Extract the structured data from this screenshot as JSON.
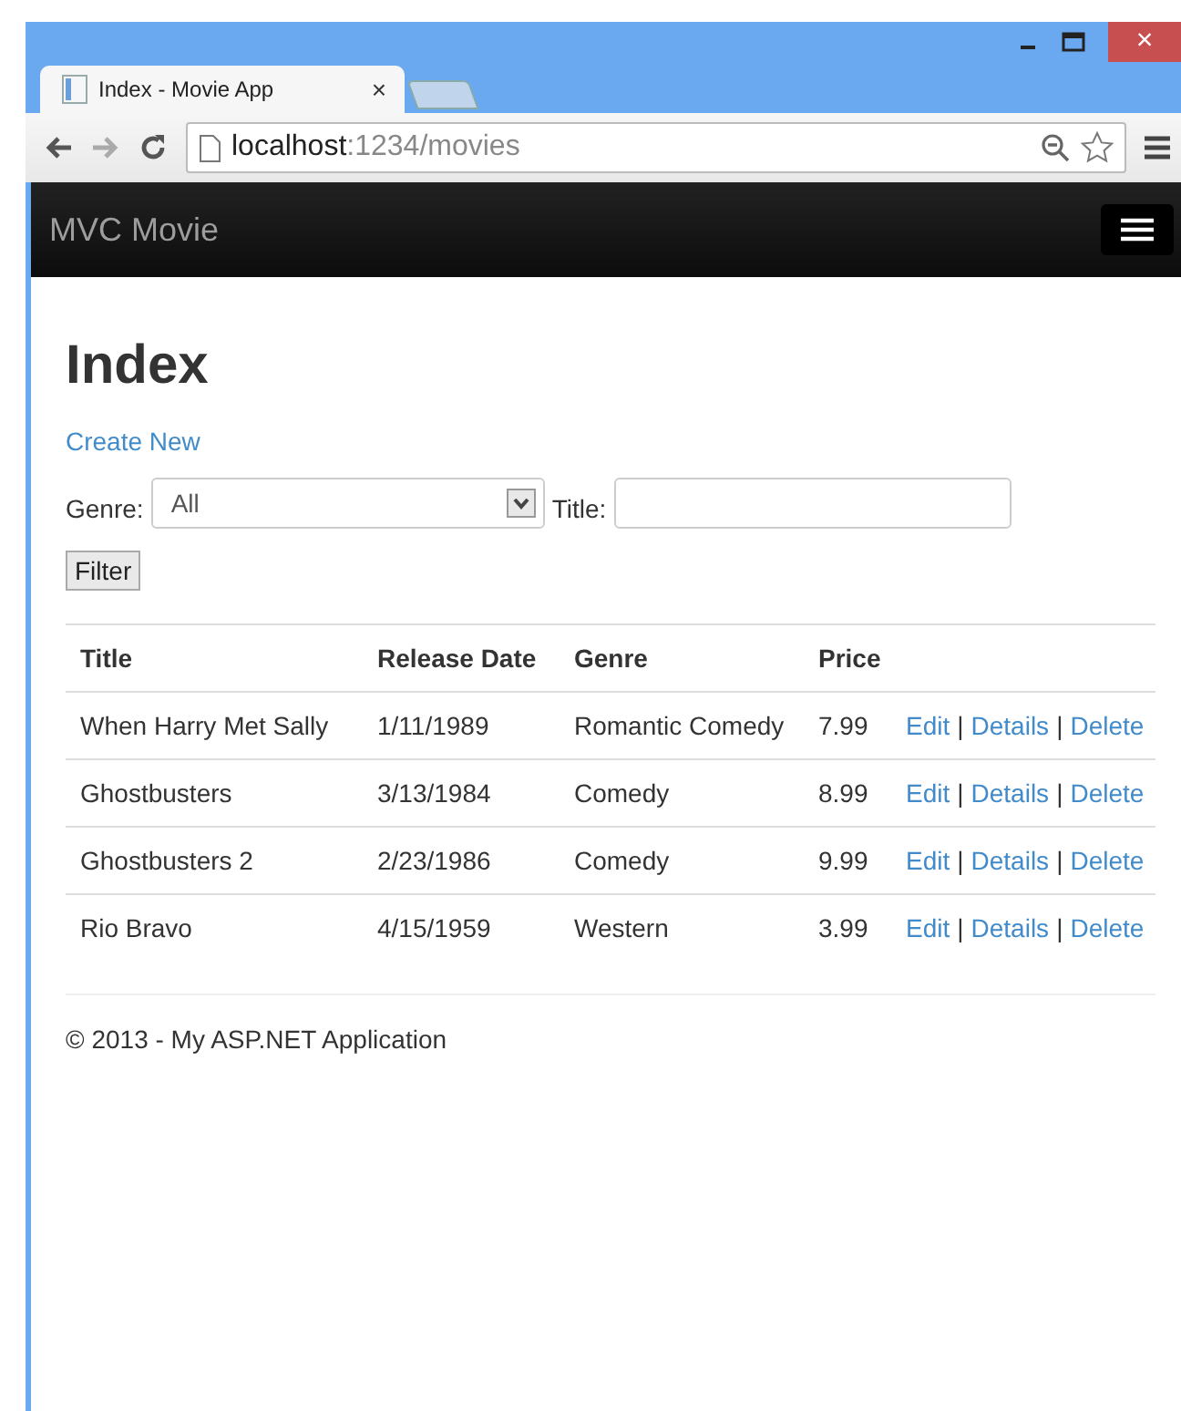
{
  "browser": {
    "tab_title": "Index - Movie App",
    "tab_close": "×",
    "url_host": "localhost",
    "url_path": ":1234/movies",
    "window_close": "×"
  },
  "navbar": {
    "brand": "MVC Movie"
  },
  "page": {
    "heading": "Index",
    "create_link": "Create New",
    "filter": {
      "genre_label": "Genre:",
      "genre_value": "All",
      "title_label": "Title:",
      "button": "Filter"
    }
  },
  "table": {
    "columns": [
      "Title",
      "Release Date",
      "Genre",
      "Price"
    ],
    "separator": "|",
    "rows": [
      {
        "cells": [
          "When Harry Met Sally",
          "1/11/1989",
          "Romantic Comedy",
          "7.99"
        ],
        "actions": [
          "Edit",
          "Details",
          "Delete"
        ]
      },
      {
        "cells": [
          "Ghostbusters",
          "3/13/1984",
          "Comedy",
          "8.99"
        ],
        "actions": [
          "Edit",
          "Details",
          "Delete"
        ]
      },
      {
        "cells": [
          "Ghostbusters 2",
          "2/23/1986",
          "Comedy",
          "9.99"
        ],
        "actions": [
          "Edit",
          "Details",
          "Delete"
        ]
      },
      {
        "cells": [
          "Rio Bravo",
          "4/15/1959",
          "Western",
          "3.99"
        ],
        "actions": [
          "Edit",
          "Details",
          "Delete"
        ]
      }
    ]
  },
  "footer": "© 2013 - My ASP.NET Application"
}
